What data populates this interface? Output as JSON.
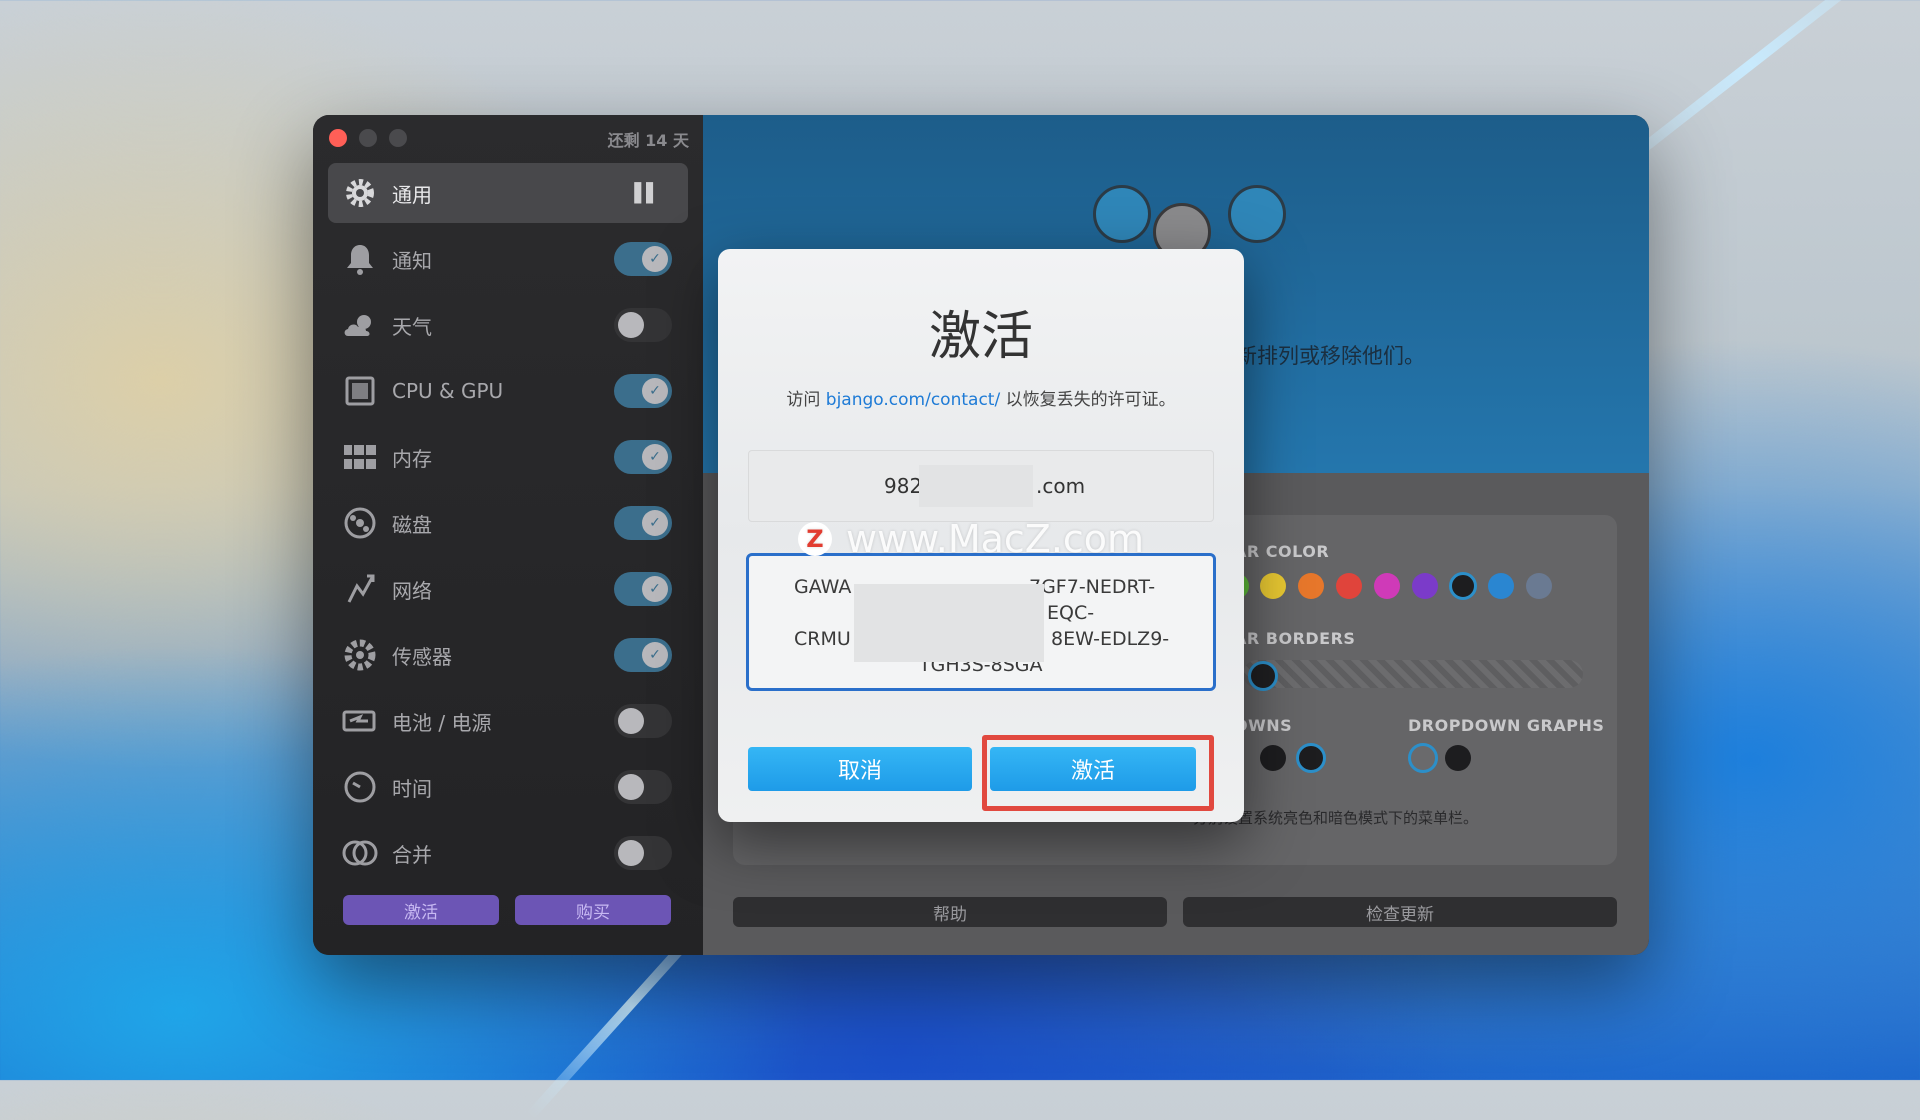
{
  "window": {
    "trial_text": "还剩 14 天"
  },
  "sidebar": {
    "items": [
      {
        "label": "通用",
        "icon": "gear-icon",
        "state": "selected"
      },
      {
        "label": "通知",
        "icon": "bell-icon",
        "state": "on"
      },
      {
        "label": "天气",
        "icon": "cloud-icon",
        "state": "off"
      },
      {
        "label": "CPU & GPU",
        "icon": "cpu-icon",
        "state": "on"
      },
      {
        "label": "内存",
        "icon": "memory-icon",
        "state": "on"
      },
      {
        "label": "磁盘",
        "icon": "disk-icon",
        "state": "on"
      },
      {
        "label": "网络",
        "icon": "network-icon",
        "state": "on"
      },
      {
        "label": "传感器",
        "icon": "sensor-icon",
        "state": "on"
      },
      {
        "label": "电池 / 电源",
        "icon": "battery-icon",
        "state": "off"
      },
      {
        "label": "时间",
        "icon": "clock-icon",
        "state": "off"
      },
      {
        "label": "合并",
        "icon": "merge-icon",
        "state": "off"
      }
    ],
    "activate_label": "激活",
    "buy_label": "购买"
  },
  "main": {
    "reorder_text": "新排列或移除他们。",
    "bar_color_label": "AR COLOR",
    "bar_borders_label": "AR BORDERS",
    "dropdowns_label": "OWNS",
    "dropdown_graphs_label": "DROPDOWN GRAPHS",
    "hint_text": "分别设置系统亮色和暗色模式下的菜单栏。",
    "help_label": "帮助",
    "check_updates_label": "检查更新",
    "swatch_colors": [
      "#5fbf3a",
      "#e8c832",
      "#e7772b",
      "#e0443b",
      "#cf3ab8",
      "#7b3bc9",
      "#1d1d1f",
      "#2a86d1",
      "#6a7a92"
    ]
  },
  "dialog": {
    "title": "激活",
    "desc_prefix": "访问 ",
    "desc_link": "bjango.com/contact/",
    "desc_suffix": " 以恢复丢失的许可证。",
    "email_prefix": "982",
    "email_suffix": ".com",
    "key_lines": [
      "GAWA",
      "7GF7-NEDRT-",
      "EQC-",
      "CRMU",
      "8EW-EDLZ9-",
      "TGH3S-8SGA"
    ],
    "watermark": "www.MacZ.com",
    "watermark_badge": "Z",
    "cancel_label": "取消",
    "activate_label": "激活"
  }
}
